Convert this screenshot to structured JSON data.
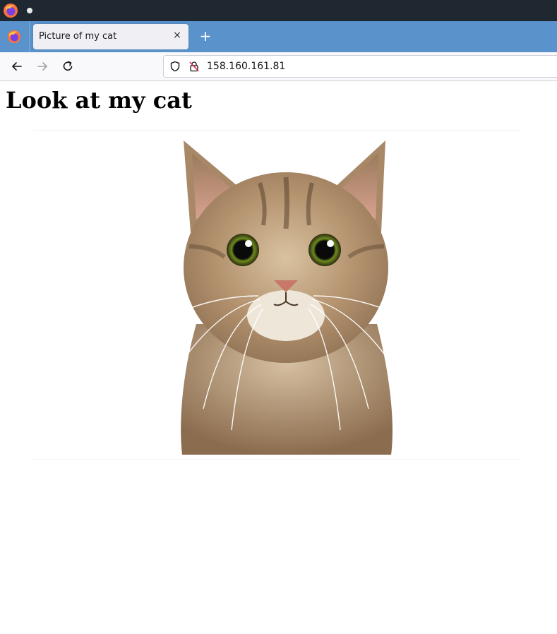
{
  "browser": {
    "tab": {
      "title": "Picture of my cat",
      "close_label": "×"
    },
    "new_tab_label": "+",
    "url": "158.160.161.81"
  },
  "page": {
    "heading": "Look at my cat",
    "image": {
      "alt": "Cat"
    }
  },
  "colors": {
    "titlebar": "#1f2730",
    "tabstrip": "#5a93cc",
    "navbar": "#f9f9fb"
  }
}
